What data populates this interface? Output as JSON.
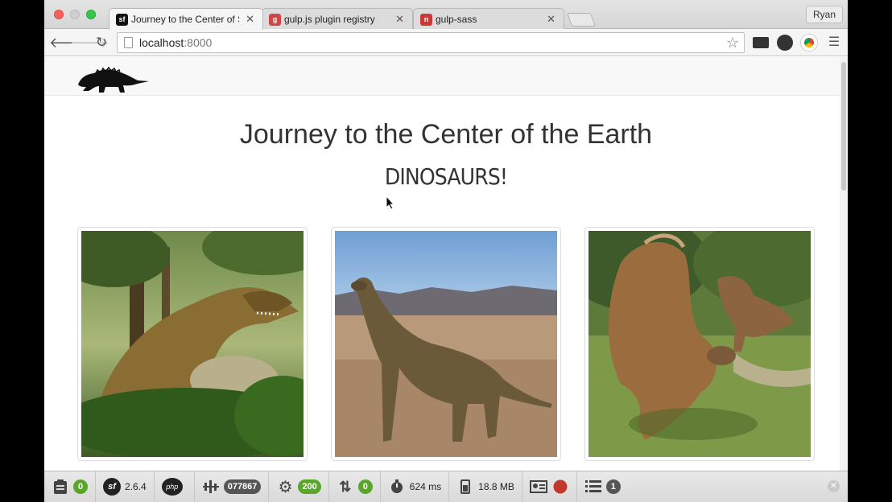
{
  "browser": {
    "tabs": [
      {
        "title": "Journey to the Center of Sy",
        "favicon": "symfony-icon",
        "active": true
      },
      {
        "title": "gulp.js plugin registry",
        "favicon": "gulp-icon",
        "active": false
      },
      {
        "title": "gulp-sass",
        "favicon": "npm-icon",
        "active": false
      }
    ],
    "profile": "Ryan",
    "url_host": "localhost",
    "url_port": ":8000"
  },
  "page": {
    "headline": "Journey to the Center of the Earth",
    "subheadline": "DINOSAURS!",
    "images": [
      {
        "subject": "t-rex"
      },
      {
        "subject": "sauropod"
      },
      {
        "subject": "triceratops"
      }
    ]
  },
  "debug_toolbar": {
    "request_count": "0",
    "symfony_version": "2.6.4",
    "php_token": "077867",
    "status_code": "200",
    "ajax_count": "0",
    "time": "624 ms",
    "memory": "18.8 MB",
    "queries": "1"
  },
  "colors": {
    "badge_green": "#59a62a",
    "badge_dark": "#555555"
  }
}
